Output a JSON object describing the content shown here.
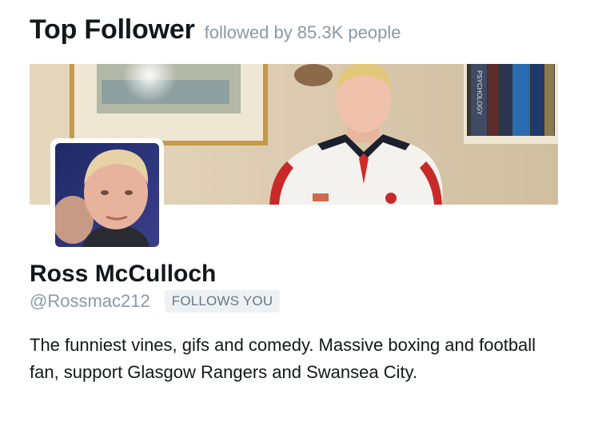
{
  "header": {
    "title": "Top Follower",
    "subtitle": "followed by 85.3K people"
  },
  "profile": {
    "name": "Ross McCulloch",
    "handle": "@Rossmac212",
    "follows_badge": "FOLLOWS YOU",
    "bio": "The funniest vines, gifs and comedy. Massive boxing and football fan, support Glasgow Rangers and Swansea City."
  },
  "banner": {
    "book_spine_text": "PSYCHOLOGY"
  }
}
